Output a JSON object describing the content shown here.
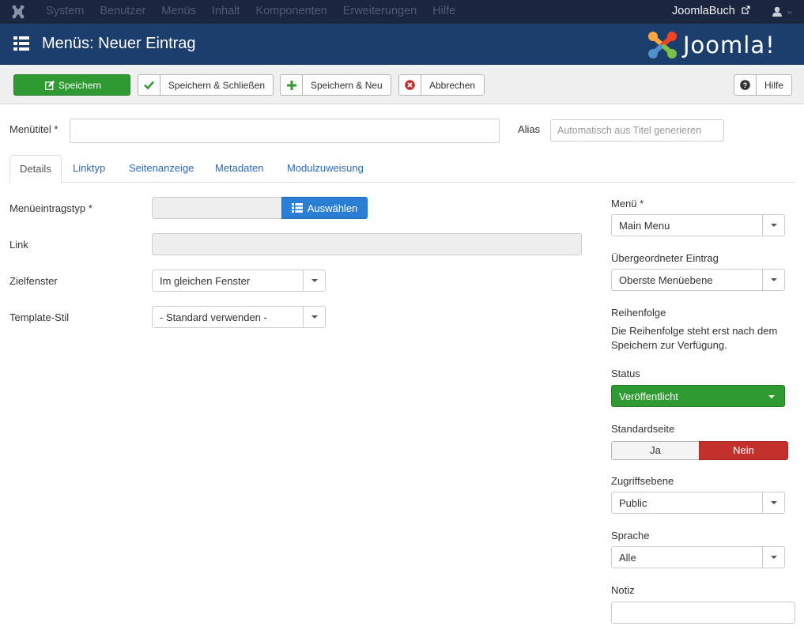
{
  "topbar": {
    "menu": [
      "System",
      "Benutzer",
      "Menüs",
      "Inhalt",
      "Komponenten",
      "Erweiterungen",
      "Hilfe"
    ],
    "site_link": "JoomlaBuch",
    "icons": {
      "logo": "joomla-logo-icon",
      "external": "external-link-icon",
      "user": "user-icon"
    }
  },
  "header": {
    "title": "Menüs: Neuer Eintrag",
    "brand": "Joomla!"
  },
  "toolbar": {
    "save": "Speichern",
    "save_close": "Speichern & Schließen",
    "save_new": "Speichern & Neu",
    "cancel": "Abbrechen",
    "help": "Hilfe"
  },
  "form": {
    "title_label": "Menütitel *",
    "title_value": "",
    "alias_label": "Alias",
    "alias_placeholder": "Automatisch aus Titel generieren"
  },
  "tabs": [
    "Details",
    "Linktyp",
    "Seitenanzeige",
    "Metadaten",
    "Modulzuweisung"
  ],
  "details": {
    "type_label": "Menüeintragstyp *",
    "type_button": "Auswählen",
    "link_label": "Link",
    "target_label": "Zielfenster",
    "target_value": "Im gleichen Fenster",
    "template_label": "Template-Stil",
    "template_value": "- Standard verwenden -"
  },
  "sidebar": {
    "menu_label": "Menü *",
    "menu_value": "Main Menu",
    "parent_label": "Übergeordneter Eintrag",
    "parent_value": "Oberste Menüebene",
    "order_label": "Reihenfolge",
    "order_help_1": "Die Reihenfolge steht erst nach dem",
    "order_help_2": "Speichern zur Verfügung.",
    "status_label": "Status",
    "status_value": "Veröffentlicht",
    "default_label": "Standardseite",
    "default_yes": "Ja",
    "default_no": "Nein",
    "access_label": "Zugriffsebene",
    "access_value": "Public",
    "language_label": "Sprache",
    "language_value": "Alle",
    "note_label": "Notiz",
    "note_value": ""
  },
  "colors": {
    "navbar": "#1a2540",
    "header": "#1b3e6c",
    "success": "#2f9a32",
    "primary": "#2a7fd4",
    "danger": "#c4302b"
  }
}
